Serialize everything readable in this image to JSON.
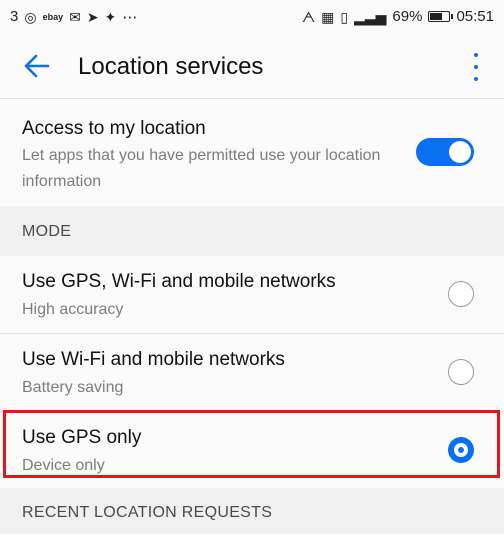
{
  "status_bar": {
    "left_text": "3",
    "ebay_label": "ebay",
    "more_dots": "⋯",
    "battery_percent": "69%",
    "battery_level": 0.69,
    "time": "05:51"
  },
  "app_bar": {
    "title": "Location services"
  },
  "access": {
    "title": "Access to my location",
    "subtitle": "Let apps that you have permitted use your location information",
    "enabled": true
  },
  "mode_section": {
    "header": "MODE",
    "options": [
      {
        "title": "Use GPS, Wi-Fi and mobile networks",
        "subtitle": "High accuracy",
        "selected": false
      },
      {
        "title": "Use Wi-Fi and mobile networks",
        "subtitle": "Battery saving",
        "selected": false
      },
      {
        "title": "Use GPS only",
        "subtitle": "Device only",
        "selected": true
      }
    ]
  },
  "recent_section": {
    "header": "RECENT LOCATION REQUESTS"
  },
  "colors": {
    "accent": "#0a6ff0",
    "highlight": "#e3141b"
  }
}
